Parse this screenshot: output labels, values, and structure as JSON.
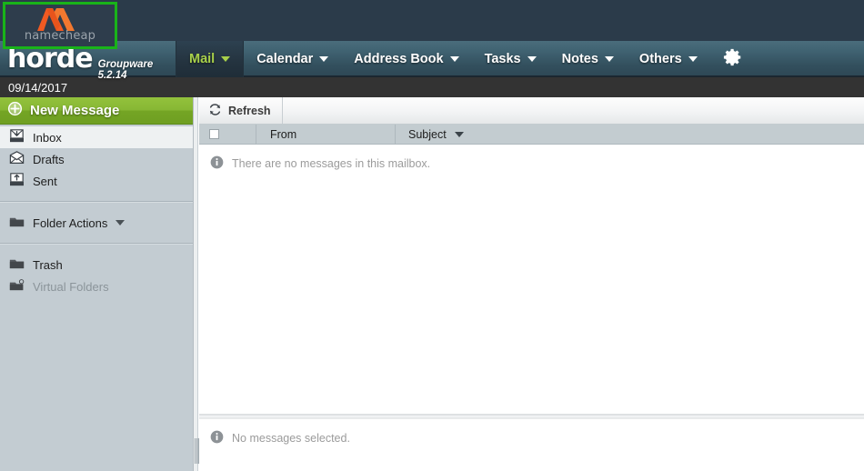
{
  "brand": {
    "logo_alt": "namecheap",
    "logo_word": "namecheap",
    "app_name": "horde",
    "app_sub": "Groupware 5.2.14"
  },
  "menu": {
    "items": [
      {
        "label": "Mail",
        "active": true
      },
      {
        "label": "Calendar",
        "active": false
      },
      {
        "label": "Address Book",
        "active": false
      },
      {
        "label": "Tasks",
        "active": false
      },
      {
        "label": "Notes",
        "active": false
      },
      {
        "label": "Others",
        "active": false
      }
    ],
    "settings_icon": "gear-icon"
  },
  "datebar": {
    "date": "09/14/2017"
  },
  "sidebar": {
    "new_message": {
      "label": "New Message",
      "icon": "plus-circle-icon"
    },
    "folders": [
      {
        "label": "Inbox",
        "icon": "inbox-icon",
        "selected": true,
        "muted": false
      },
      {
        "label": "Drafts",
        "icon": "drafts-envelope-icon",
        "selected": false,
        "muted": false
      },
      {
        "label": "Sent",
        "icon": "sent-icon",
        "selected": false,
        "muted": false
      }
    ],
    "actions": [
      {
        "label": "Folder Actions",
        "icon": "folder-icon",
        "has_caret": true
      }
    ],
    "special": [
      {
        "label": "Trash",
        "icon": "folder-icon",
        "muted": false
      },
      {
        "label": "Virtual Folders",
        "icon": "virtual-folder-icon",
        "muted": true
      }
    ]
  },
  "mailbox": {
    "toolbar": {
      "refresh_label": "Refresh",
      "refresh_icon": "refresh-icon"
    },
    "columns": {
      "from": "From",
      "subject": "Subject",
      "sorted_by": "Subject"
    },
    "rows": [],
    "empty_message": "There are no messages in this mailbox.",
    "status_message": "No messages selected."
  },
  "colors": {
    "brand_bar": "#2b3b4a",
    "menu_bar": "#3e606f",
    "active_tab_text": "#a8d04a",
    "new_message_green": "#87b734",
    "sidebar_bg": "#c3ccd2",
    "column_header_bg": "#c3ccd0",
    "highlight_box": "#19b319",
    "namecheap_orange": "#f05a22"
  }
}
